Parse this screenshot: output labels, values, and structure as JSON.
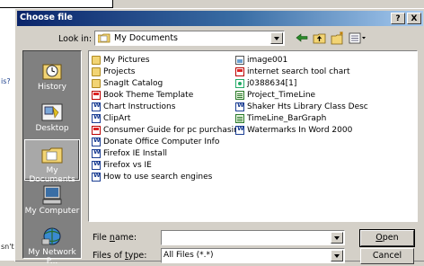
{
  "background": {
    "text_1": "is?",
    "text_2": "sn't"
  },
  "dialog": {
    "title": "Choose file",
    "help_label": "?",
    "close_label": "X",
    "look_in": {
      "label": "Look in:",
      "value": "My Documents"
    },
    "places": [
      {
        "label": "History",
        "icon": "history-icon"
      },
      {
        "label": "Desktop",
        "icon": "desktop-icon"
      },
      {
        "label": "My Documents",
        "icon": "my-documents-icon"
      },
      {
        "label": "My Computer",
        "icon": "my-computer-icon"
      },
      {
        "label": "My Network P...",
        "icon": "my-network-places-icon"
      }
    ],
    "files_col1": [
      {
        "name": "My Pictures",
        "type": "folder"
      },
      {
        "name": "Projects",
        "type": "folder"
      },
      {
        "name": "SnagIt Catalog",
        "type": "folder"
      },
      {
        "name": "Book Theme Template",
        "type": "pdf"
      },
      {
        "name": "Chart Instructions",
        "type": "doc"
      },
      {
        "name": "ClipArt",
        "type": "doc"
      },
      {
        "name": "Consumer Guide for pc purchasing",
        "type": "pdf"
      },
      {
        "name": "Donate Office Computer Info",
        "type": "doc"
      },
      {
        "name": "Firefox IE Install",
        "type": "doc"
      },
      {
        "name": "Firefox vs IE",
        "type": "doc"
      },
      {
        "name": "How to use search engines",
        "type": "doc"
      }
    ],
    "files_col2": [
      {
        "name": "image001",
        "type": "img"
      },
      {
        "name": "internet search tool chart",
        "type": "pdf"
      },
      {
        "name": "j0388634[1]",
        "type": "gif"
      },
      {
        "name": "Project_TimeLine",
        "type": "proj"
      },
      {
        "name": "Shaker Hts Library Class Desc",
        "type": "doc"
      },
      {
        "name": "TimeLine_BarGraph",
        "type": "proj"
      },
      {
        "name": "Watermarks In Word 2000",
        "type": "doc"
      }
    ],
    "file_name": {
      "label_prefix": "File ",
      "label_accel": "n",
      "label_suffix": "ame:",
      "value": ""
    },
    "file_type": {
      "label_prefix": "Files of ",
      "label_accel": "t",
      "label_suffix": "ype:",
      "value": "All Files (*.*)"
    },
    "open_label_accel": "O",
    "open_label_rest": "pen",
    "cancel_label": "Cancel"
  }
}
